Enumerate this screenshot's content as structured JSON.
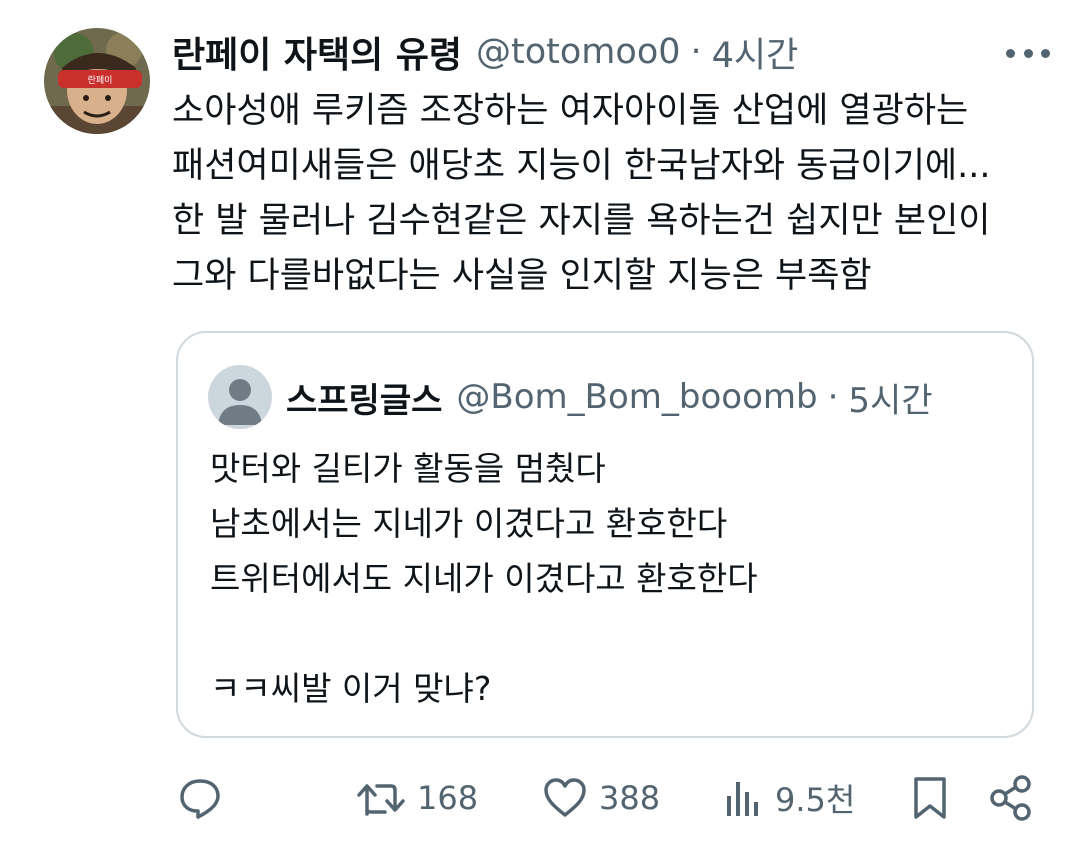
{
  "tweet": {
    "author": {
      "display_name": "란페이 자택의 유령",
      "handle": "@totomoo0",
      "time": "4시간",
      "avatar_text": "란페이"
    },
    "separator": "·",
    "lines": [
      "소아성애 루키즘 조장하는 여자아이돌 산업에 열광하는",
      "패션여미새들은 애당초 지능이 한국남자와 동급이기에...",
      "한 발 물러나 김수현같은 자지를 욕하는건 쉽지만 본인이",
      "그와 다를바없다는 사실을 인지할 지능은 부족함"
    ]
  },
  "quote": {
    "author": {
      "display_name": "스프링글스",
      "handle": "@Bom_Bom_booomb",
      "time": "5시간"
    },
    "separator": "·",
    "lines": [
      "맛터와 길티가 활동을 멈췄다",
      "남초에서는 지네가 이겼다고 환호한다",
      "트위터에서도 지네가 이겼다고 환호한다"
    ],
    "last_line": "ㅋㅋ씨발 이거 맞냐?"
  },
  "actions": {
    "reply": {
      "icon": "reply-icon"
    },
    "retweet": {
      "icon": "retweet-icon",
      "count": "168"
    },
    "like": {
      "icon": "heart-icon",
      "count": "388"
    },
    "views": {
      "icon": "views-icon",
      "count": "9.5천"
    },
    "bookmark": {
      "icon": "bookmark-icon"
    },
    "share": {
      "icon": "share-icon"
    }
  },
  "colors": {
    "text": "#0f1419",
    "secondary": "#536471",
    "border": "#cfd9de"
  }
}
